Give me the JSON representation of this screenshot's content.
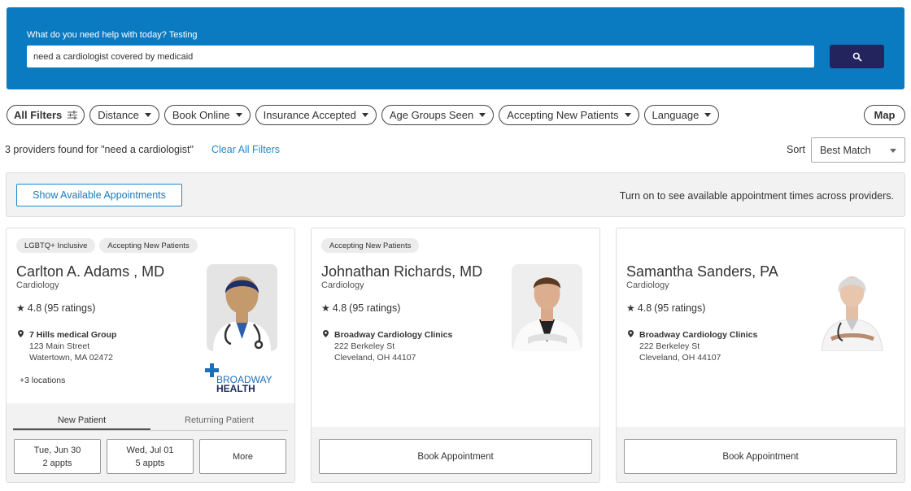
{
  "search": {
    "label": "What do you need help with today? Testing",
    "value": "need a cardiologist covered by medicaid",
    "button_icon": "search-icon"
  },
  "filters": {
    "all": "All Filters",
    "items": [
      "Distance",
      "Book Online",
      "Insurance Accepted",
      "Age Groups Seen",
      "Accepting New Patients",
      "Language"
    ],
    "map": "Map"
  },
  "results": {
    "summary": "3 providers found for \"need a cardiologist\"",
    "clear": "Clear All Filters",
    "sort_label": "Sort",
    "sort_value": "Best Match"
  },
  "appointments": {
    "button": "Show Available Appointments",
    "hint": "Turn on to see available appointment times across providers."
  },
  "providers": [
    {
      "tags": [
        "LGBTQ+ Inclusive",
        "Accepting New Patients"
      ],
      "name": "Carlton A. Adams , MD",
      "specialty": "Cardiology",
      "rating": "4.8",
      "ratings_count": "(95 ratings)",
      "location_name": "7 Hills medical Group",
      "address1": "123 Main Street",
      "address2": "Watertown, MA 02472",
      "more_locations": "+3 locations",
      "brand_top": "BROADWAY",
      "brand_bottom": "HEALTH",
      "tab_new": "New Patient",
      "tab_returning": "Returning Patient",
      "slots": [
        {
          "day": "Tue, Jun 30",
          "count": "2 appts"
        },
        {
          "day": "Wed, Jul 01",
          "count": "5 appts"
        }
      ],
      "more": "More"
    },
    {
      "tags": [
        "Accepting New Patients"
      ],
      "name": "Johnathan Richards, MD",
      "specialty": "Cardiology",
      "rating": "4.8",
      "ratings_count": "(95 ratings)",
      "location_name": "Broadway Cardiology Clinics",
      "address1": "222 Berkeley St",
      "address2": "Cleveland, OH 44107",
      "book": "Book Appointment"
    },
    {
      "name": "Samantha Sanders, PA",
      "specialty": "Cardiology",
      "rating": "4.8",
      "ratings_count": "(95 ratings)",
      "location_name": "Broadway Cardiology Clinics",
      "address1": "222 Berkeley St",
      "address2": "Cleveland, OH 44107",
      "book": "Book Appointment"
    }
  ],
  "colors": {
    "banner": "#0b7bc1",
    "search_button": "#23235e",
    "link": "#1f8ad0",
    "brand_blue": "#1d6fb8",
    "brand_navy": "#1e2a5a"
  }
}
